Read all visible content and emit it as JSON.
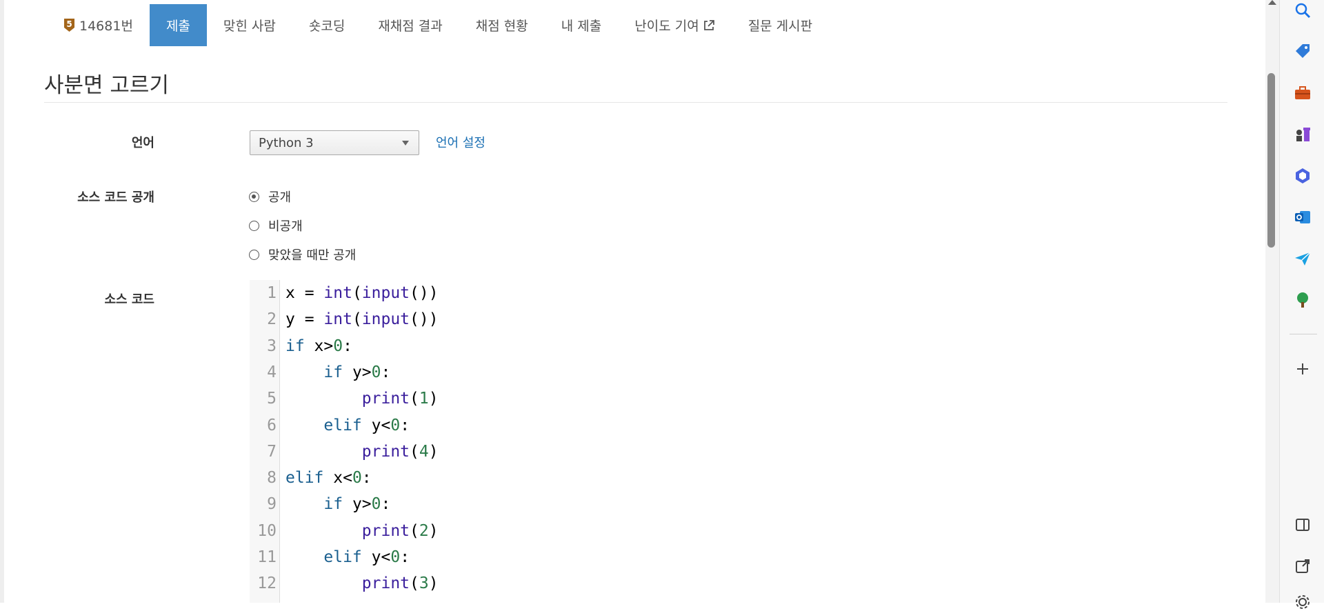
{
  "nav": {
    "problem_number": "14681번",
    "items": [
      {
        "label": "제출",
        "active": true
      },
      {
        "label": "맞힌 사람"
      },
      {
        "label": "숏코딩"
      },
      {
        "label": "재채점 결과"
      },
      {
        "label": "채점 현황"
      },
      {
        "label": "내 제출"
      },
      {
        "label": "난이도 기여"
      },
      {
        "label": "질문 게시판"
      }
    ],
    "badge_tier": "5"
  },
  "page": {
    "title": "사분면 고르기"
  },
  "form": {
    "language_label": "언어",
    "language_selected": "Python 3",
    "language_settings_link": "언어 설정",
    "visibility_label": "소스 코드 공개",
    "visibility_options": [
      "공개",
      "비공개",
      "맞았을 때만 공개"
    ],
    "visibility_selected": 0,
    "source_label": "소스 코드"
  },
  "code_lines": [
    "x = int(input())",
    "y = int(input())",
    "if x>0:",
    "    if y>0:",
    "        print(1)",
    "    elif y<0:",
    "        print(4)",
    "elif x<0:",
    "    if y>0:",
    "        print(2)",
    "    elif y<0:",
    "        print(3)"
  ],
  "colors": {
    "active_tab": "#428bca",
    "link": "#1a6fb3",
    "badge": "#a3651a",
    "keyword": "#1a5f8f",
    "builtin": "#3a1e9c",
    "number": "#2a7a48"
  },
  "sidebar_icons": [
    "search-icon",
    "tag-icon",
    "toolbox-icon",
    "chess-icon",
    "copilot-icon",
    "outlook-icon",
    "send-icon",
    "tree-icon",
    "add-icon",
    "split-view-icon",
    "external-open-icon",
    "settings-icon"
  ]
}
